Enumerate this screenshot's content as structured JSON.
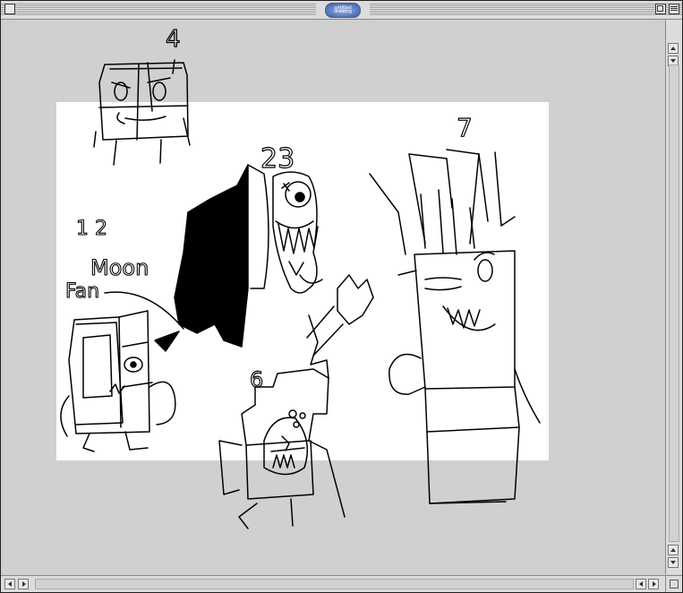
{
  "window": {
    "title": "untitled drawing"
  },
  "canvas": {
    "page_color": "#ffffff",
    "background_color": "#d0d0d0",
    "doodles": [
      {
        "kind": "character",
        "description": "small square creature top-left"
      },
      {
        "kind": "character",
        "description": "tall cloaked figure with big eye"
      },
      {
        "kind": "character",
        "description": "tall spiky-haired character right"
      },
      {
        "kind": "character",
        "description": "square character bottom-left"
      },
      {
        "kind": "character",
        "description": "grumpy block character bottom-center"
      }
    ]
  },
  "labels": {
    "num_4": "4",
    "num_23": "23",
    "num_7": "7",
    "num_1_2": "1 2",
    "moon": "Moon",
    "fan": "Fan",
    "num_6": "6"
  },
  "icons": {
    "close": "close-box-icon",
    "zoom": "zoom-box-icon",
    "collapse": "windowshade-icon",
    "up": "arrow-up-icon",
    "down": "arrow-down-icon",
    "left": "arrow-left-icon",
    "right": "arrow-right-icon",
    "grow": "resize-grip-icon"
  }
}
